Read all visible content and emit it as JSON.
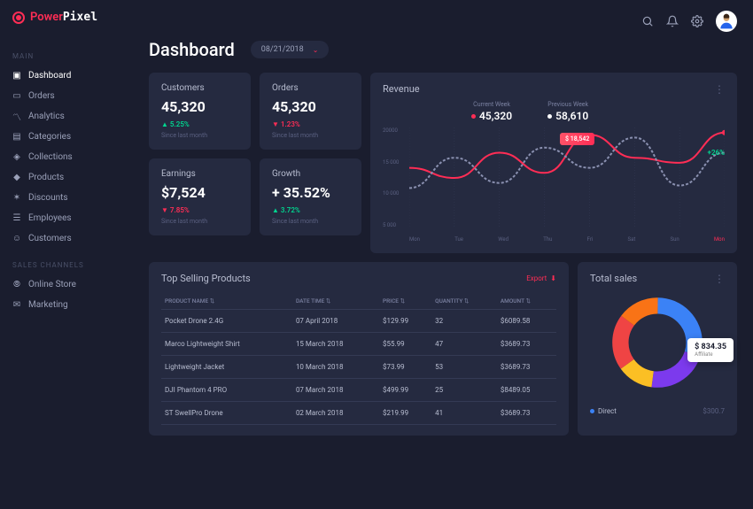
{
  "logo": {
    "part1": "Power",
    "part2": "Pixel"
  },
  "nav": {
    "sections": [
      {
        "label": "MAIN",
        "items": [
          {
            "icon": "dashboard",
            "label": "Dashboard",
            "active": true
          },
          {
            "icon": "orders",
            "label": "Orders"
          },
          {
            "icon": "analytics",
            "label": "Analytics"
          },
          {
            "icon": "categories",
            "label": "Categories"
          },
          {
            "icon": "collections",
            "label": "Collections"
          },
          {
            "icon": "products",
            "label": "Products"
          },
          {
            "icon": "discounts",
            "label": "Discounts"
          },
          {
            "icon": "employees",
            "label": "Employees"
          },
          {
            "icon": "customers",
            "label": "Customers"
          }
        ]
      },
      {
        "label": "SALES CHANNELS",
        "items": [
          {
            "icon": "store",
            "label": "Online Store"
          },
          {
            "icon": "marketing",
            "label": "Marketing"
          }
        ]
      }
    ]
  },
  "header": {
    "title": "Dashboard",
    "date": "08/21/2018"
  },
  "stats": [
    {
      "label": "Customers",
      "value": "45,320",
      "delta": "5.25%",
      "dir": "up",
      "caption": "Since last month"
    },
    {
      "label": "Orders",
      "value": "45,320",
      "delta": "1.23%",
      "dir": "down",
      "caption": "Since last month"
    },
    {
      "label": "Earnings",
      "value": "$7,524",
      "delta": "7.85%",
      "dir": "down",
      "caption": "Since last month"
    },
    {
      "label": "Growth",
      "value": "+ 35.52%",
      "delta": "3.72%",
      "dir": "up",
      "caption": "Since last month"
    }
  ],
  "revenue": {
    "title": "Revenue",
    "legends": [
      {
        "label": "Current Week",
        "value": "45,320",
        "color": "red"
      },
      {
        "label": "Previous Week",
        "value": "58,610",
        "color": "white"
      }
    ],
    "tooltip": "$ 18,542",
    "pct_badge": "+26%"
  },
  "chart_data": {
    "type": "line",
    "categories": [
      "Mon",
      "Tue",
      "Wed",
      "Thu",
      "Fri",
      "Sat",
      "Sun",
      "Mon"
    ],
    "series": [
      {
        "name": "Current Week",
        "values": [
          12000,
          10000,
          15000,
          11000,
          18542,
          14000,
          13000,
          19000
        ]
      },
      {
        "name": "Previous Week",
        "values": [
          8000,
          14000,
          9000,
          16000,
          12000,
          18000,
          8500,
          15000
        ]
      }
    ],
    "yticks": [
      "20000",
      "15 000",
      "10 000",
      "5 000"
    ],
    "ylim": [
      0,
      20000
    ],
    "active_x": 7
  },
  "table": {
    "title": "Top Selling Products",
    "export": "Export",
    "columns": [
      "PRODUCT NAME",
      "DATE TIME",
      "PRICE",
      "QUANTITY",
      "AMOUNT"
    ],
    "rows": [
      [
        "Pocket Drone 2.4G",
        "07 April 2018",
        "$129.99",
        "32",
        "$6089.58"
      ],
      [
        "Marco Lightweight Shirt",
        "15 March 2018",
        "$55.99",
        "47",
        "$3689.73"
      ],
      [
        "Lightweight Jacket",
        "10 March 2018",
        "$73.99",
        "53",
        "$3689.73"
      ],
      [
        "DJI Phantom 4 PRO",
        "07 March 2018",
        "$499.99",
        "25",
        "$8489.05"
      ],
      [
        "ST SwellPro Drone",
        "02 March 2018",
        "$219.99",
        "41",
        "$3689.73"
      ]
    ]
  },
  "sales": {
    "title": "Total sales",
    "tooltip_value": "$ 834.35",
    "tooltip_label": "Affiliate",
    "legend_item": "Direct",
    "legend_value": "$300.7",
    "segments": [
      {
        "name": "Blue",
        "value": 30,
        "color": "#3b82f6"
      },
      {
        "name": "Purple",
        "value": 22,
        "color": "#7c3aed"
      },
      {
        "name": "Yellow",
        "value": 13,
        "color": "#fbbf24"
      },
      {
        "name": "Red",
        "value": 20,
        "color": "#ef4444"
      },
      {
        "name": "Orange",
        "value": 15,
        "color": "#f97316"
      }
    ]
  }
}
